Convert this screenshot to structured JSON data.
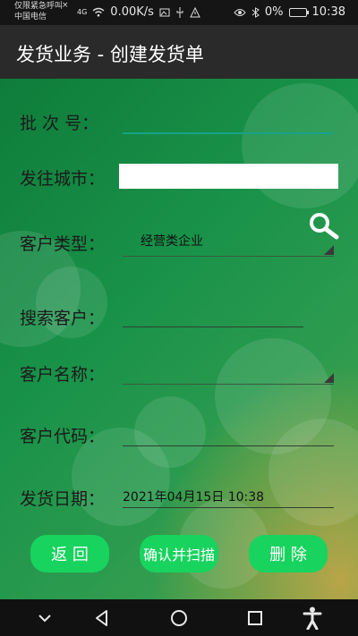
{
  "status_bar": {
    "carrier_line1": "仅限紧急呼叫",
    "carrier_line2": "中国电信",
    "close_glyph": "×",
    "signal_tag": "4G",
    "speed": "0.00K/s",
    "battery": "0%",
    "battery_level": 0,
    "time": "10:38"
  },
  "header": {
    "title": "发货业务 - 创建发货单"
  },
  "form": {
    "batch_label": "批 次 号：",
    "batch_value": "",
    "city_label": "发往城市：",
    "city_value": "",
    "customer_type_label": "客户类型：",
    "customer_type_value": "经营类企业",
    "search_customer_label": "搜索客户：",
    "search_customer_value": "",
    "customer_name_label": "客户名称：",
    "customer_name_value": "",
    "customer_code_label": "客户代码：",
    "customer_code_value": "",
    "ship_date_label": "发货日期：",
    "ship_date_value": "2021年04月15日 10:38"
  },
  "buttons": {
    "back": "返 回",
    "confirm_scan": "确认并扫描",
    "delete": "删 除"
  },
  "colors": {
    "accent": "#18d35e",
    "focus_underline": "#17a28a",
    "title_bar": "#2a2a2a"
  },
  "icons": [
    "search-icon",
    "back-nav-icon",
    "home-nav-icon",
    "recents-nav-icon",
    "accessibility-icon",
    "chevron-down-icon"
  ]
}
